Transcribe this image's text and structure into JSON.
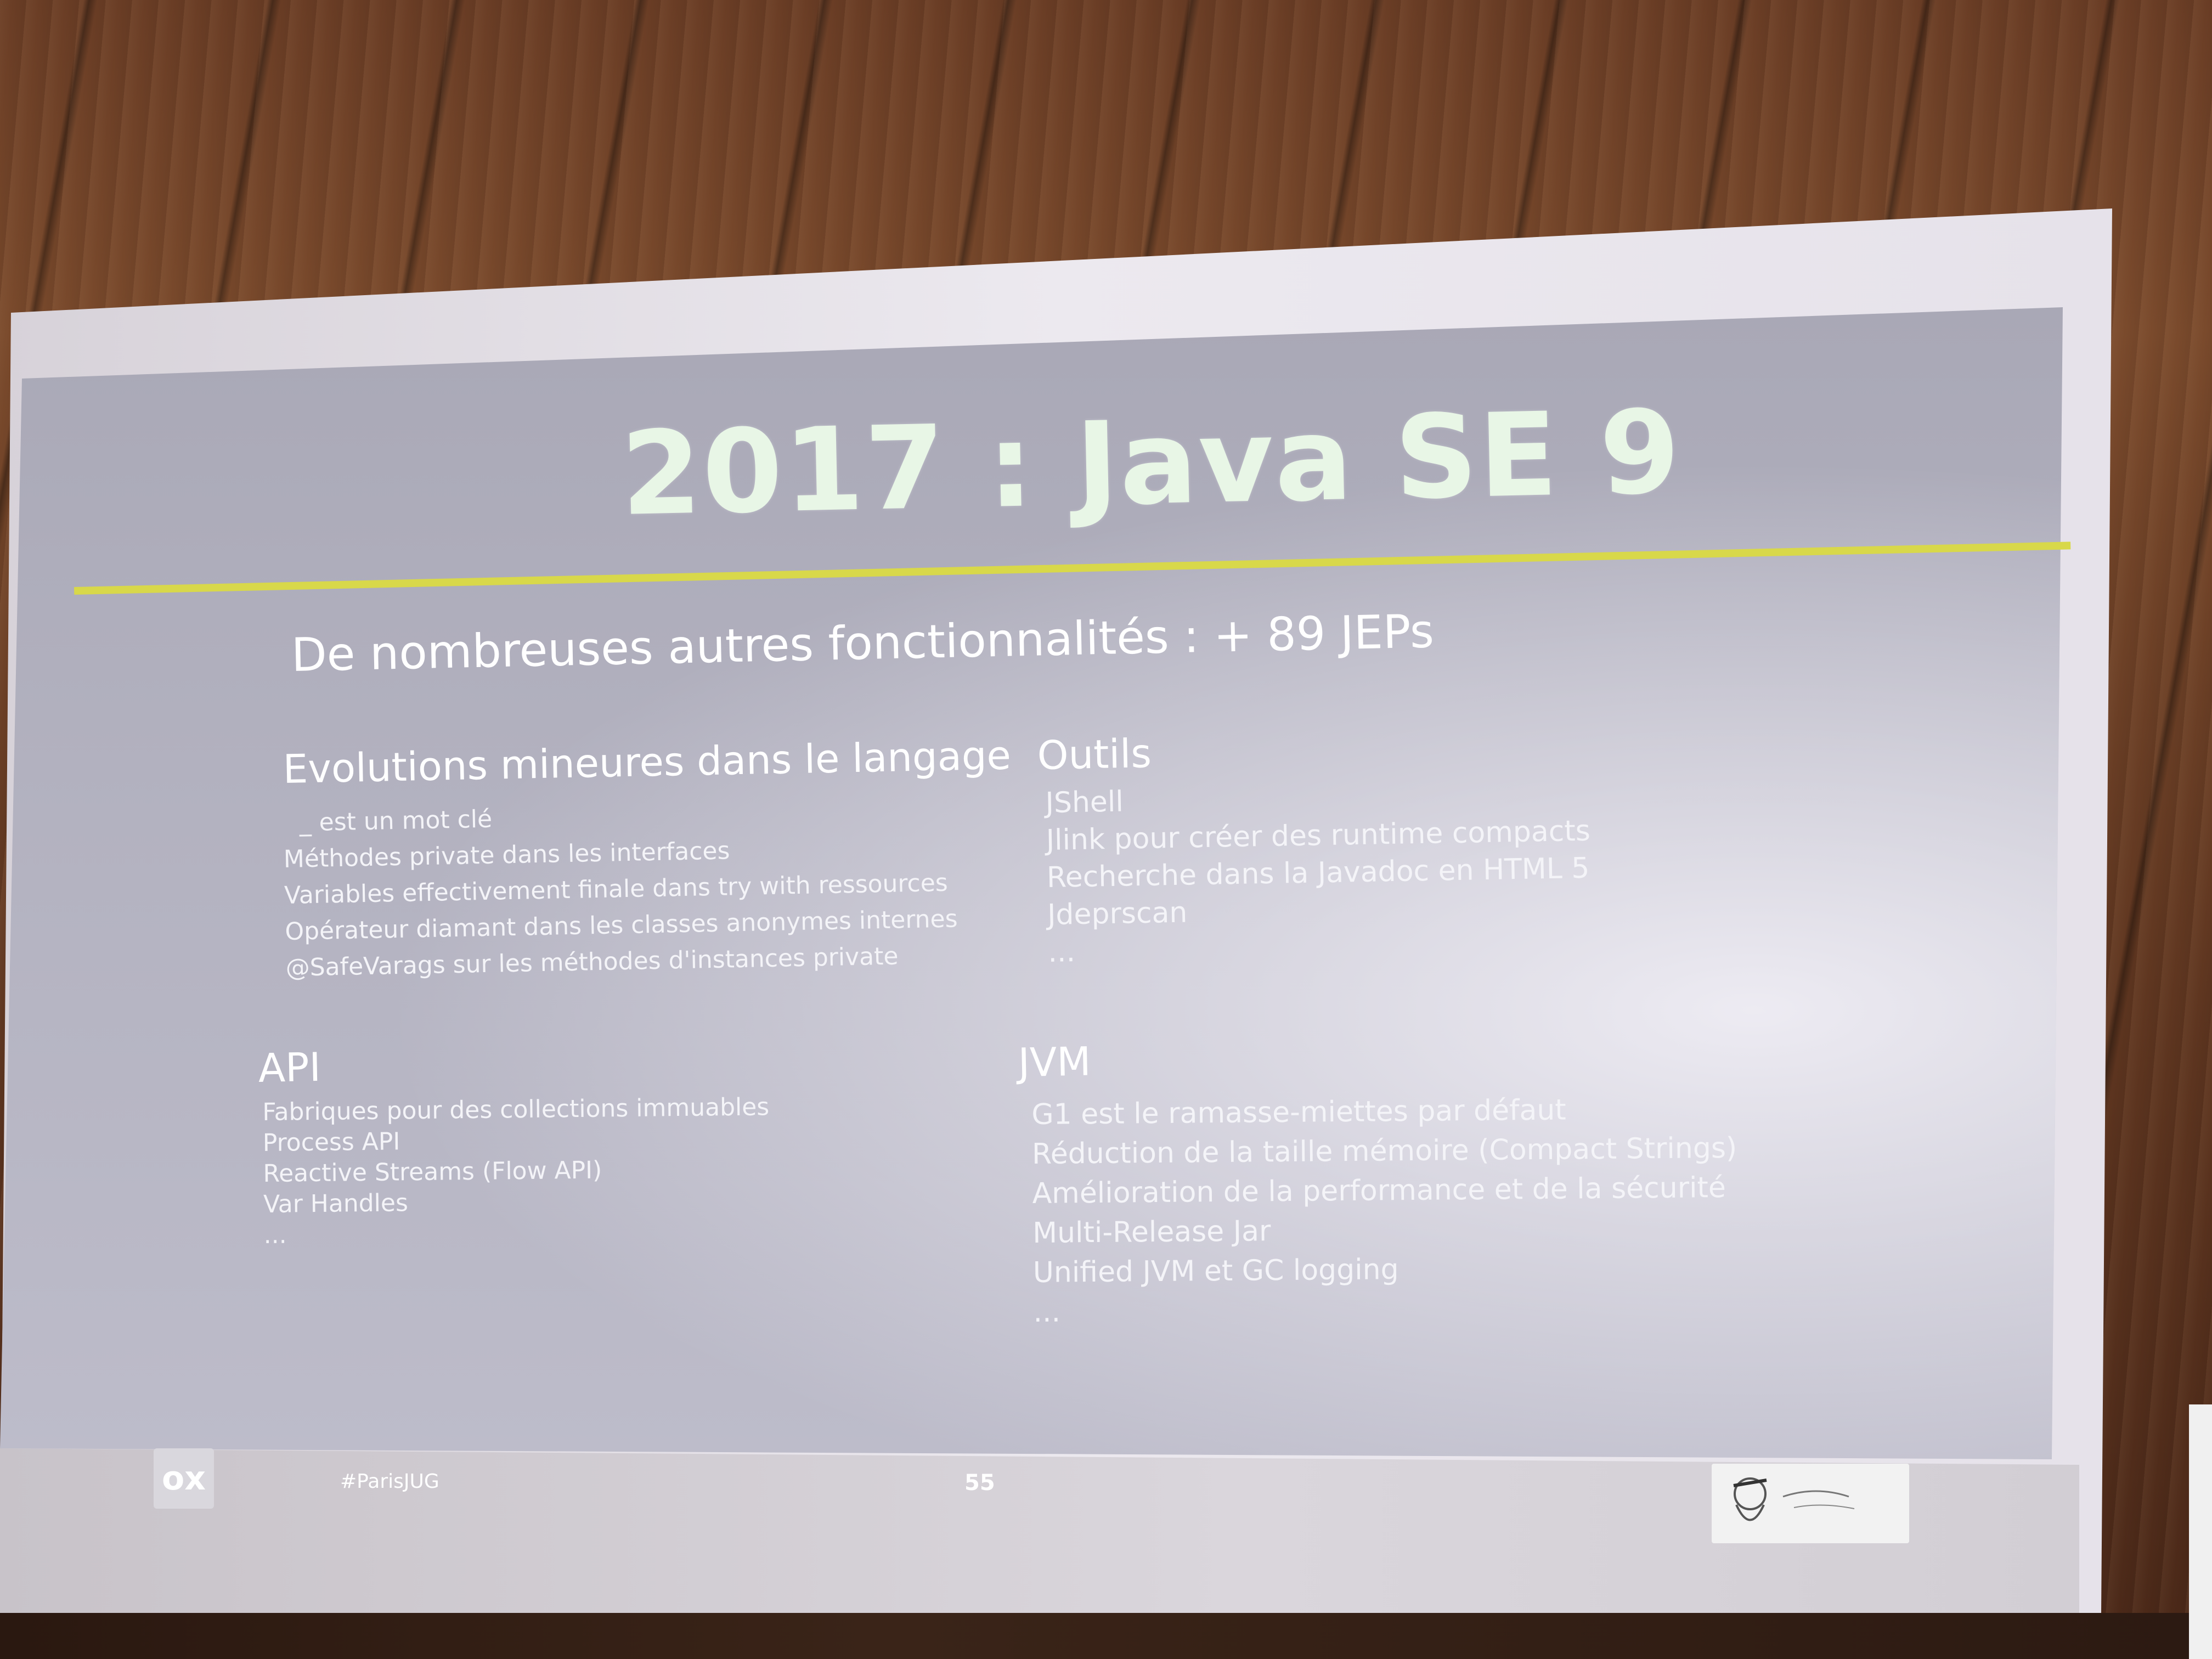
{
  "slide": {
    "title": "2017 : Java SE 9",
    "subtitle": "De nombreuses autres fonctionnalités : + 89 JEPs",
    "sections": {
      "langage": {
        "title": "Evolutions mineures dans le langage",
        "items": [
          "_ est un mot clé",
          "Méthodes private dans les interfaces",
          "Variables effectivement finale dans try with ressources",
          "Opérateur diamant dans les classes anonymes internes",
          "@SafeVarags sur les méthodes d'instances private"
        ]
      },
      "outils": {
        "title": "Outils",
        "items": [
          "JShell",
          "Jlink pour créer des runtime compacts",
          "Recherche dans la Javadoc en HTML 5",
          "Jdeprscan",
          "..."
        ]
      },
      "api": {
        "title": "API",
        "items": [
          "Fabriques pour des collections immuables",
          "Process API",
          "Reactive Streams (Flow API)",
          "Var Handles",
          "..."
        ]
      },
      "jvm": {
        "title": "JVM",
        "items": [
          "G1 est le ramasse-miettes par défaut",
          "Réduction de la taille mémoire (Compact Strings)",
          "Amélioration de la performance et de la sécurité",
          "Multi-Release Jar",
          "Unified JVM et GC logging",
          "..."
        ]
      }
    },
    "footer": {
      "logo_text": "ox",
      "hashtag": "#ParisJUG",
      "page_number": "55"
    },
    "colors": {
      "title": "#e8f6e6",
      "rule": "#d8d84a",
      "text": "#ffffff"
    }
  }
}
